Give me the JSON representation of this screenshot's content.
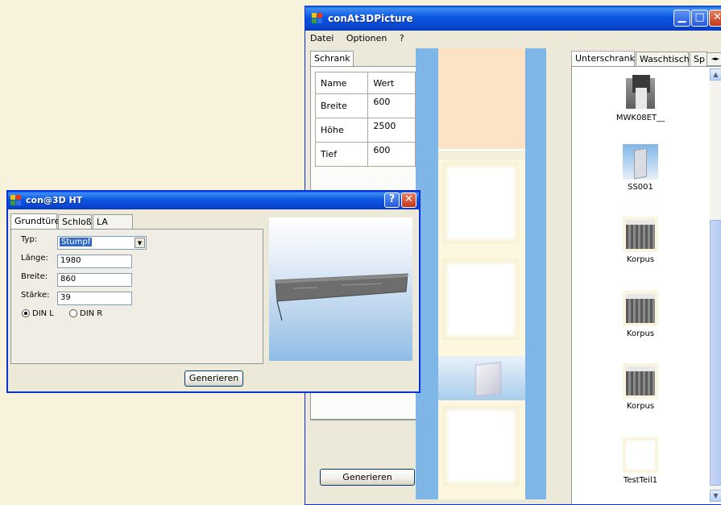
{
  "main_window": {
    "title": "conAt3DPicture",
    "menu": [
      "Datei",
      "Optionen",
      "?"
    ],
    "left_tab": "Schrank",
    "grid": {
      "headers": [
        "Name",
        "Wert"
      ],
      "rows": [
        {
          "name": "Breite",
          "value": "600"
        },
        {
          "name": "Höhe",
          "value": "2500"
        },
        {
          "name": "Tief",
          "value": "600"
        }
      ]
    },
    "generate_label": "Generieren",
    "right_tabs": [
      "Unterschrank",
      "Waschtisch",
      "Sp"
    ],
    "library_items": [
      {
        "label": "MWK08ET__",
        "icon": "cabinet-corner-icon"
      },
      {
        "label": "SS001",
        "icon": "glass-door-icon"
      },
      {
        "label": "Korpus",
        "icon": "korpus-icon"
      },
      {
        "label": "Korpus",
        "icon": "korpus-icon"
      },
      {
        "label": "Korpus",
        "icon": "korpus-icon"
      },
      {
        "label": "TestTeil1",
        "icon": "blank-part-icon"
      }
    ]
  },
  "dialog": {
    "title": "con@3D HT",
    "tabs": [
      "Grundtüre",
      "Schloß",
      "LA"
    ],
    "fields": {
      "typ_label": "Typ:",
      "typ_value": "Stumpf",
      "laenge_label": "Länge:",
      "laenge_value": "1980",
      "breite_label": "Breite:",
      "breite_value": "860",
      "staerke_label": "Stärke:",
      "staerke_value": "39"
    },
    "radio_left": "DIN L",
    "radio_right": "DIN R",
    "selected_radio": "DIN L",
    "generate_label": "Generieren"
  },
  "colors": {
    "titlebar": "#0a56e0",
    "desktop": "#f7f2dc",
    "preview_blue": "#7fb6e8"
  }
}
